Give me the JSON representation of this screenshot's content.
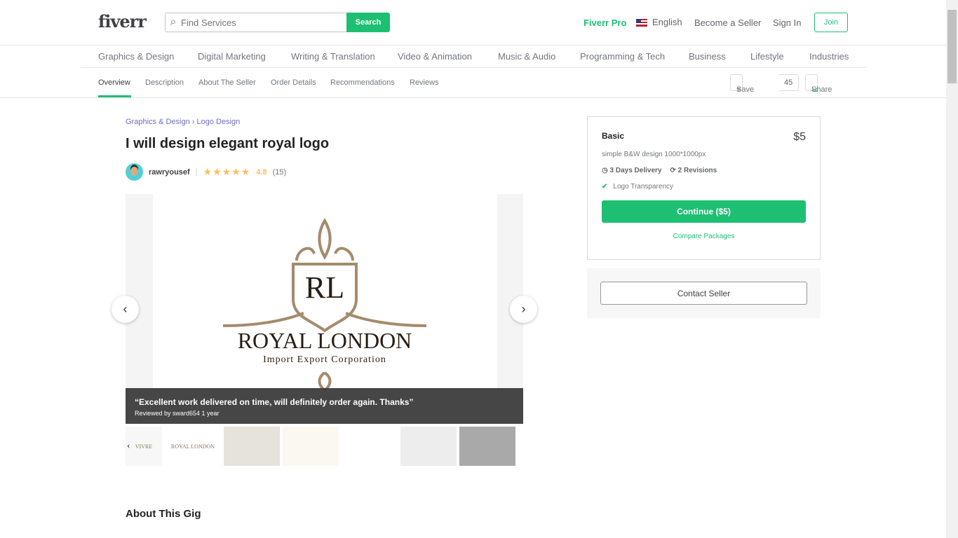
{
  "header": {
    "logo": "fiverr",
    "search_placeholder": "Find Services",
    "search_button": "Search",
    "fiverr_pro": "Fiverr Pro",
    "language": "English",
    "become_seller": "Become a Seller",
    "sign_in": "Sign In",
    "join": "Join"
  },
  "categories": [
    "Graphics & Design",
    "Digital Marketing",
    "Writing & Translation",
    "Video & Animation",
    "Music & Audio",
    "Programming & Tech",
    "Business",
    "Lifestyle",
    "Industries"
  ],
  "subnav": {
    "items": [
      "Overview",
      "Description",
      "About The Seller",
      "Order Details",
      "Recommendations",
      "Reviews"
    ],
    "save": "Save",
    "save_count": "45",
    "share": "Share"
  },
  "breadcrumb": [
    "Graphics & Design",
    "Logo Design"
  ],
  "gig": {
    "title": "I will design elegant royal logo",
    "seller": "rawryousef",
    "rating": "4.8",
    "rating_count": "(15)",
    "stars": 5
  },
  "gallery": {
    "logo_monogram": "RL",
    "logo_name": "ROYAL LONDON",
    "logo_tagline": "Import Export Corporation",
    "review_quote": "“Excellent work delivered on time, will definitely order again. Thanks”",
    "review_by": "Reviewed by sward654 1 year",
    "thumbs": [
      "VIVRE",
      "ROYAL LONDON",
      "",
      "",
      "",
      "",
      ""
    ]
  },
  "about_title": "About This Gig",
  "package": {
    "name": "Basic",
    "price": "$5",
    "description": "simple B&W design 1000*1000px",
    "delivery": "3 Days Delivery",
    "revisions": "2 Revisions",
    "feature": "Logo Transparency",
    "continue": "Continue ($5)",
    "compare": "Compare Packages",
    "contact": "Contact Seller"
  },
  "colors": {
    "accent": "#1dbf73",
    "star": "#ffbe5b",
    "breadcrumb": "#6e6ec2"
  }
}
